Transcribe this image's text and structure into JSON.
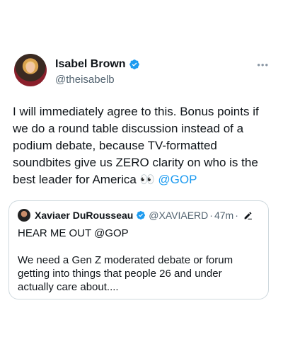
{
  "tweet": {
    "display_name": "Isabel Brown",
    "handle": "@theisabelb",
    "more_label": "•••",
    "text_main": "I will immediately agree to this. Bonus points if we do a round table discussion instead of a podium debate, because TV-formatted soundbites give us ZERO clarity on who is the best leader for America 👀 ",
    "mention": "@GOP",
    "verified_icon": "verified-badge-icon"
  },
  "quoted": {
    "display_name": "Xaviaer DuRousseau",
    "handle": "@XAVIAERD",
    "dot": "·",
    "time": "47m",
    "line1": "HEAR ME OUT @GOP",
    "line2": "We need a Gen Z moderated debate or forum getting into things that people 26 and under actually care about...."
  },
  "colors": {
    "link": "#1d9bf0",
    "verified": "#1d9bf0",
    "border": "#cfd9de",
    "muted": "#536471"
  }
}
